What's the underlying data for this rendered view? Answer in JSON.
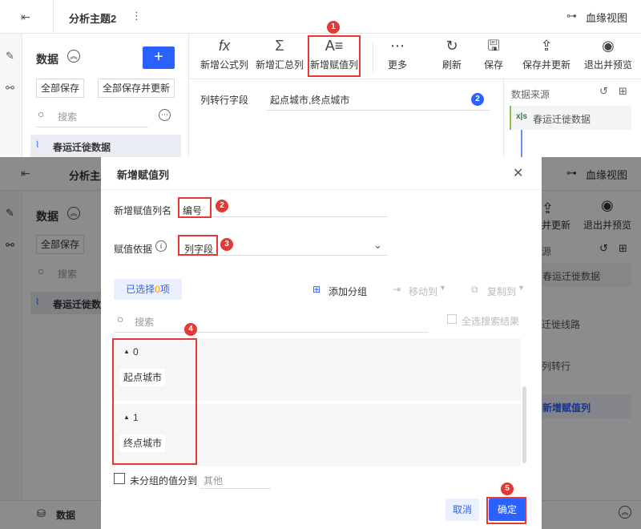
{
  "header": {
    "title": "分析主题2",
    "more_icon": "more-vertical-icon",
    "lineage": "血缘视图"
  },
  "data_panel": {
    "title": "数据",
    "save_all": "全部保存",
    "save_all_update": "全部保存并更新",
    "search_placeholder": "搜索",
    "dataset": "春运迁徙数据"
  },
  "toolbar": {
    "items": [
      {
        "label": "新增公式列",
        "icon": "fx"
      },
      {
        "label": "新增汇总列",
        "icon": "Σ"
      },
      {
        "label": "新增赋值列",
        "icon": "A≡"
      },
      {
        "label": "更多",
        "icon": "⋯"
      },
      {
        "label": "刷新",
        "icon": "↻"
      },
      {
        "label": "保存",
        "icon": "🖫"
      },
      {
        "label": "保存并更新",
        "icon": "⇪"
      },
      {
        "label": "退出并预览",
        "icon": "◉"
      }
    ]
  },
  "config": {
    "label": "列转行字段",
    "value": "起点城市,终点城市"
  },
  "source_panel": {
    "title": "数据来源",
    "item": "春运迁徙数据",
    "xls": "x|s"
  },
  "bg_source_items": [
    "春运迁徙数据",
    "迁徙线路",
    "列转行",
    "新增赋值列"
  ],
  "bg_toolbar": {
    "save_update_partial": "并更新",
    "exit_preview": "退出并预览",
    "source_partial": "源"
  },
  "bottom": {
    "label": "数据"
  },
  "dialog": {
    "title": "新增赋值列",
    "name_label": "新增赋值列名",
    "name_value": "编号",
    "basis_label": "赋值依据",
    "basis_value": "列字段",
    "selected_tab": "已选择",
    "selected_count": "0",
    "selected_suffix": "项",
    "add_group": "添加分组",
    "move_to": "移动到",
    "copy_to": "复制到",
    "search_placeholder": "搜索",
    "select_all_results": "全选搜索结果",
    "groups": [
      {
        "name": "0",
        "item": "起点城市"
      },
      {
        "name": "1",
        "item": "终点城市"
      }
    ],
    "ungrouped_label": "未分组的值分到",
    "ungrouped_placeholder": "其他",
    "cancel": "取消",
    "ok": "确定"
  },
  "badges": [
    "1",
    "2",
    "2",
    "3",
    "4",
    "5"
  ]
}
